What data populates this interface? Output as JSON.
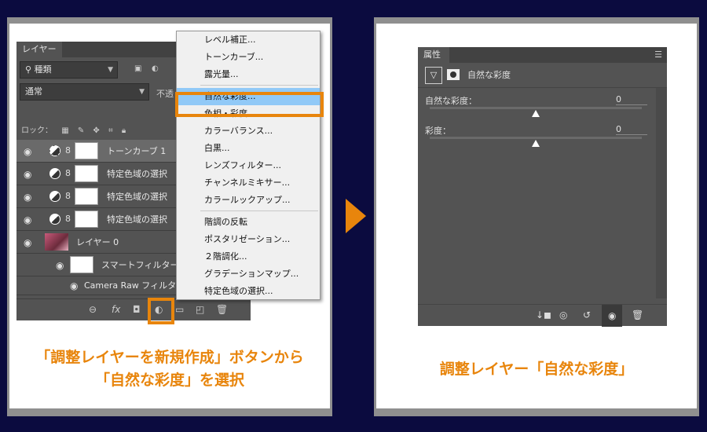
{
  "left": {
    "panel_tab": "レイヤー",
    "filter_label": "種類",
    "blend_mode": "通常",
    "opacity_label": "不透",
    "lock_label": "ロック：",
    "layers": [
      {
        "name": "トーンカーブ 1"
      },
      {
        "name": "特定色域の選択"
      },
      {
        "name": "特定色域の選択"
      },
      {
        "name": "特定色域の選択"
      },
      {
        "name": "レイヤー 0"
      },
      {
        "name": "スマートフィルター"
      },
      {
        "name": "Camera Raw フィルター"
      }
    ],
    "menu_items": [
      "レベル補正...",
      "トーンカーブ...",
      "露光量...",
      "自然な彩度...",
      "色相・彩度...",
      "カラーバランス...",
      "白黒...",
      "レンズフィルター...",
      "チャンネルミキサー...",
      "カラールックアップ...",
      "階調の反転",
      "ポスタリゼーション...",
      "２階調化...",
      "グラデーションマップ...",
      "特定色域の選択..."
    ],
    "caption_line1": "「調整レイヤーを新規作成」ボタンから",
    "caption_line2": "「自然な彩度」を選択"
  },
  "right": {
    "panel_tab": "属性",
    "header_title": "自然な彩度",
    "sliders": [
      {
        "label": "自然な彩度：",
        "value": "0"
      },
      {
        "label": "彩度：",
        "value": "0"
      }
    ],
    "caption": "調整レイヤー「自然な彩度」"
  },
  "colors": {
    "accent": "#e8850c",
    "background": "#0b0b3f",
    "panel": "#535353",
    "menu_highlight": "#91c9f7"
  }
}
